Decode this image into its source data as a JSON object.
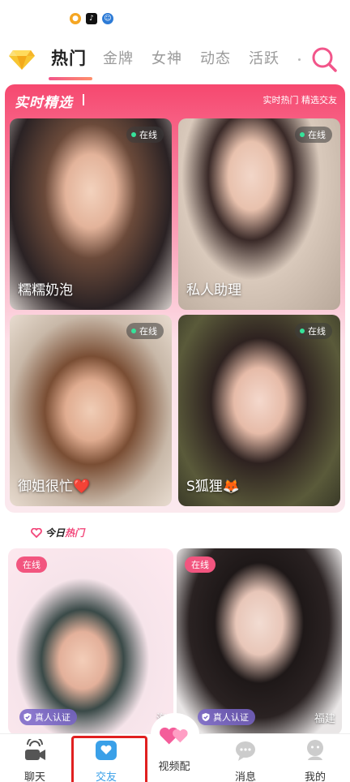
{
  "status_icons": [
    "weibo-icon",
    "tiktok-icon",
    "robot-icon"
  ],
  "tabs": [
    {
      "label": "热门",
      "active": true
    },
    {
      "label": "金牌",
      "active": false
    },
    {
      "label": "女神",
      "active": false
    },
    {
      "label": "动态",
      "active": false
    },
    {
      "label": "活跃",
      "active": false
    }
  ],
  "featured": {
    "title": "实时精选",
    "subtitle": "实时热门 精选交友",
    "cards": [
      {
        "name": "糯糯奶泡",
        "status": "在线"
      },
      {
        "name": "私人助理",
        "status": "在线"
      },
      {
        "name": "御姐很忙❤️",
        "status": "在线"
      },
      {
        "name": "S狐狸🦊",
        "status": "在线"
      }
    ]
  },
  "today_hot": {
    "prefix": "今日",
    "hot": "热门"
  },
  "profiles": [
    {
      "status": "在线",
      "verify": "真人认证",
      "city": "海"
    },
    {
      "status": "在线",
      "verify": "真人认证",
      "city": "福建"
    }
  ],
  "nav": [
    {
      "label": "聊天",
      "icon": "video-chat-icon"
    },
    {
      "label": "交友",
      "icon": "heart-box-icon",
      "active": true
    },
    {
      "label": "视频配",
      "icon": "hearts-match-icon"
    },
    {
      "label": "消息",
      "icon": "message-icon"
    },
    {
      "label": "我的",
      "icon": "profile-icon"
    }
  ],
  "colors": {
    "accent": "#f2477a",
    "active_nav": "#3aa0e8",
    "online": "#36e39a"
  }
}
